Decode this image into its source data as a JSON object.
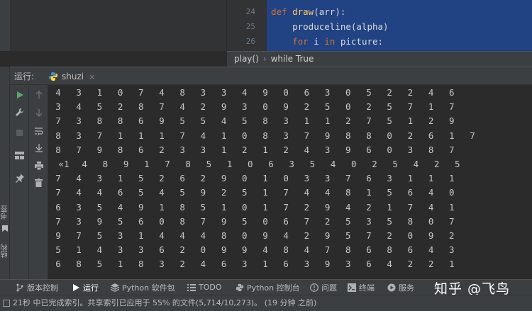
{
  "editor": {
    "lines": [
      {
        "num": "24",
        "parts": [
          {
            "t": "def ",
            "c": "kw"
          },
          {
            "t": "draw",
            "c": "fn"
          },
          {
            "t": "(arr):",
            "c": "tx"
          }
        ]
      },
      {
        "num": "25",
        "parts": [
          {
            "t": "    produceline(alpha)",
            "c": "tx"
          }
        ]
      },
      {
        "num": "26",
        "parts": [
          {
            "t": "    ",
            "c": "tx"
          },
          {
            "t": "for",
            "c": "kw"
          },
          {
            "t": " i ",
            "c": "tx"
          },
          {
            "t": "in",
            "c": "kw"
          },
          {
            "t": " picture:",
            "c": "tx"
          }
        ]
      }
    ],
    "breadcrumb": [
      "play()",
      "while True"
    ]
  },
  "run_panel": {
    "title": "运行:",
    "tab_label": "shuzi",
    "close_glyph": "×"
  },
  "left_strip_labels": [
    "书签",
    "结构"
  ],
  "console_rows": [
    [
      "4",
      "3",
      "1",
      "0",
      "7",
      "4",
      "8",
      "3",
      "3",
      "4",
      "9",
      "0",
      "6",
      "3",
      "0",
      "5",
      "2",
      "2",
      "4",
      "6"
    ],
    [
      "3",
      "4",
      "5",
      "2",
      "8",
      "7",
      "4",
      "2",
      "9",
      "3",
      "0",
      "9",
      "2",
      "5",
      "0",
      "2",
      "5",
      "7",
      "1",
      "7"
    ],
    [
      "7",
      "3",
      "8",
      "8",
      "6",
      "9",
      "5",
      "5",
      "4",
      "5",
      "8",
      "3",
      "1",
      "1",
      "2",
      "7",
      "5",
      "1",
      "2",
      "9"
    ],
    [
      "8",
      "3",
      "7",
      "1",
      "1",
      "1",
      "7",
      "4",
      "1",
      "0",
      "8",
      "3",
      "7",
      "9",
      "8",
      "8",
      "0",
      "2",
      "6",
      "1",
      "7"
    ],
    [
      "8",
      "7",
      "9",
      "8",
      "6",
      "2",
      "3",
      "3",
      "1",
      "2",
      "1",
      "2",
      "4",
      "3",
      "9",
      "6",
      "0",
      "3",
      "8",
      "7"
    ],
    [
      "«1",
      "4",
      "8",
      "9",
      "1",
      "7",
      "8",
      "5",
      "1",
      "0",
      "6",
      "3",
      "5",
      "4",
      "0",
      "2",
      "5",
      "4",
      "2",
      "5"
    ],
    [
      "7",
      "4",
      "3",
      "1",
      "5",
      "2",
      "6",
      "2",
      "9",
      "0",
      "1",
      "0",
      "3",
      "3",
      "7",
      "6",
      "3",
      "1",
      "1",
      "1"
    ],
    [
      "7",
      "4",
      "4",
      "6",
      "5",
      "4",
      "5",
      "9",
      "2",
      "5",
      "1",
      "7",
      "4",
      "4",
      "8",
      "1",
      "5",
      "6",
      "4",
      "0"
    ],
    [
      "6",
      "3",
      "5",
      "4",
      "9",
      "1",
      "8",
      "5",
      "1",
      "0",
      "1",
      "7",
      "2",
      "9",
      "4",
      "2",
      "1",
      "7",
      "4",
      "1"
    ],
    [
      "7",
      "3",
      "9",
      "5",
      "6",
      "0",
      "8",
      "7",
      "9",
      "5",
      "0",
      "6",
      "7",
      "2",
      "5",
      "3",
      "5",
      "8",
      "0",
      "7"
    ],
    [
      "9",
      "7",
      "5",
      "3",
      "1",
      "4",
      "4",
      "4",
      "8",
      "0",
      "9",
      "4",
      "2",
      "9",
      "5",
      "7",
      "2",
      "0",
      "9",
      "2"
    ],
    [
      "5",
      "1",
      "4",
      "3",
      "3",
      "6",
      "2",
      "0",
      "9",
      "9",
      "4",
      "8",
      "4",
      "7",
      "8",
      "6",
      "8",
      "6",
      "4",
      "3"
    ],
    [
      "6",
      "8",
      "5",
      "1",
      "8",
      "3",
      "2",
      "4",
      "6",
      "3",
      "1",
      "6",
      "3",
      "9",
      "3",
      "6",
      "4",
      "2",
      "2",
      "1"
    ]
  ],
  "bottom_tools": [
    {
      "label": "版本控制",
      "icon": "branch-icon"
    },
    {
      "label": "运行",
      "icon": "run-icon",
      "active": true
    },
    {
      "label": "Python 软件包",
      "icon": "packages-icon"
    },
    {
      "label": "TODO",
      "icon": "list-icon"
    },
    {
      "label": "Python 控制台",
      "icon": "python-console-icon"
    },
    {
      "label": "问题",
      "icon": "problems-icon"
    },
    {
      "label": "终端",
      "icon": "terminal-icon"
    },
    {
      "label": "服务",
      "icon": "services-icon"
    }
  ],
  "watermark": "知乎 @飞鸟",
  "status": "21秒 中已完成索引。共享索引已应用于 55% 的文件(5,714/10,273)。 (19 分钟 之前)",
  "colors": {
    "selection": "#214283",
    "keyword": "#cc7832",
    "function": "#ffc66d",
    "run_green": "#59a869"
  }
}
